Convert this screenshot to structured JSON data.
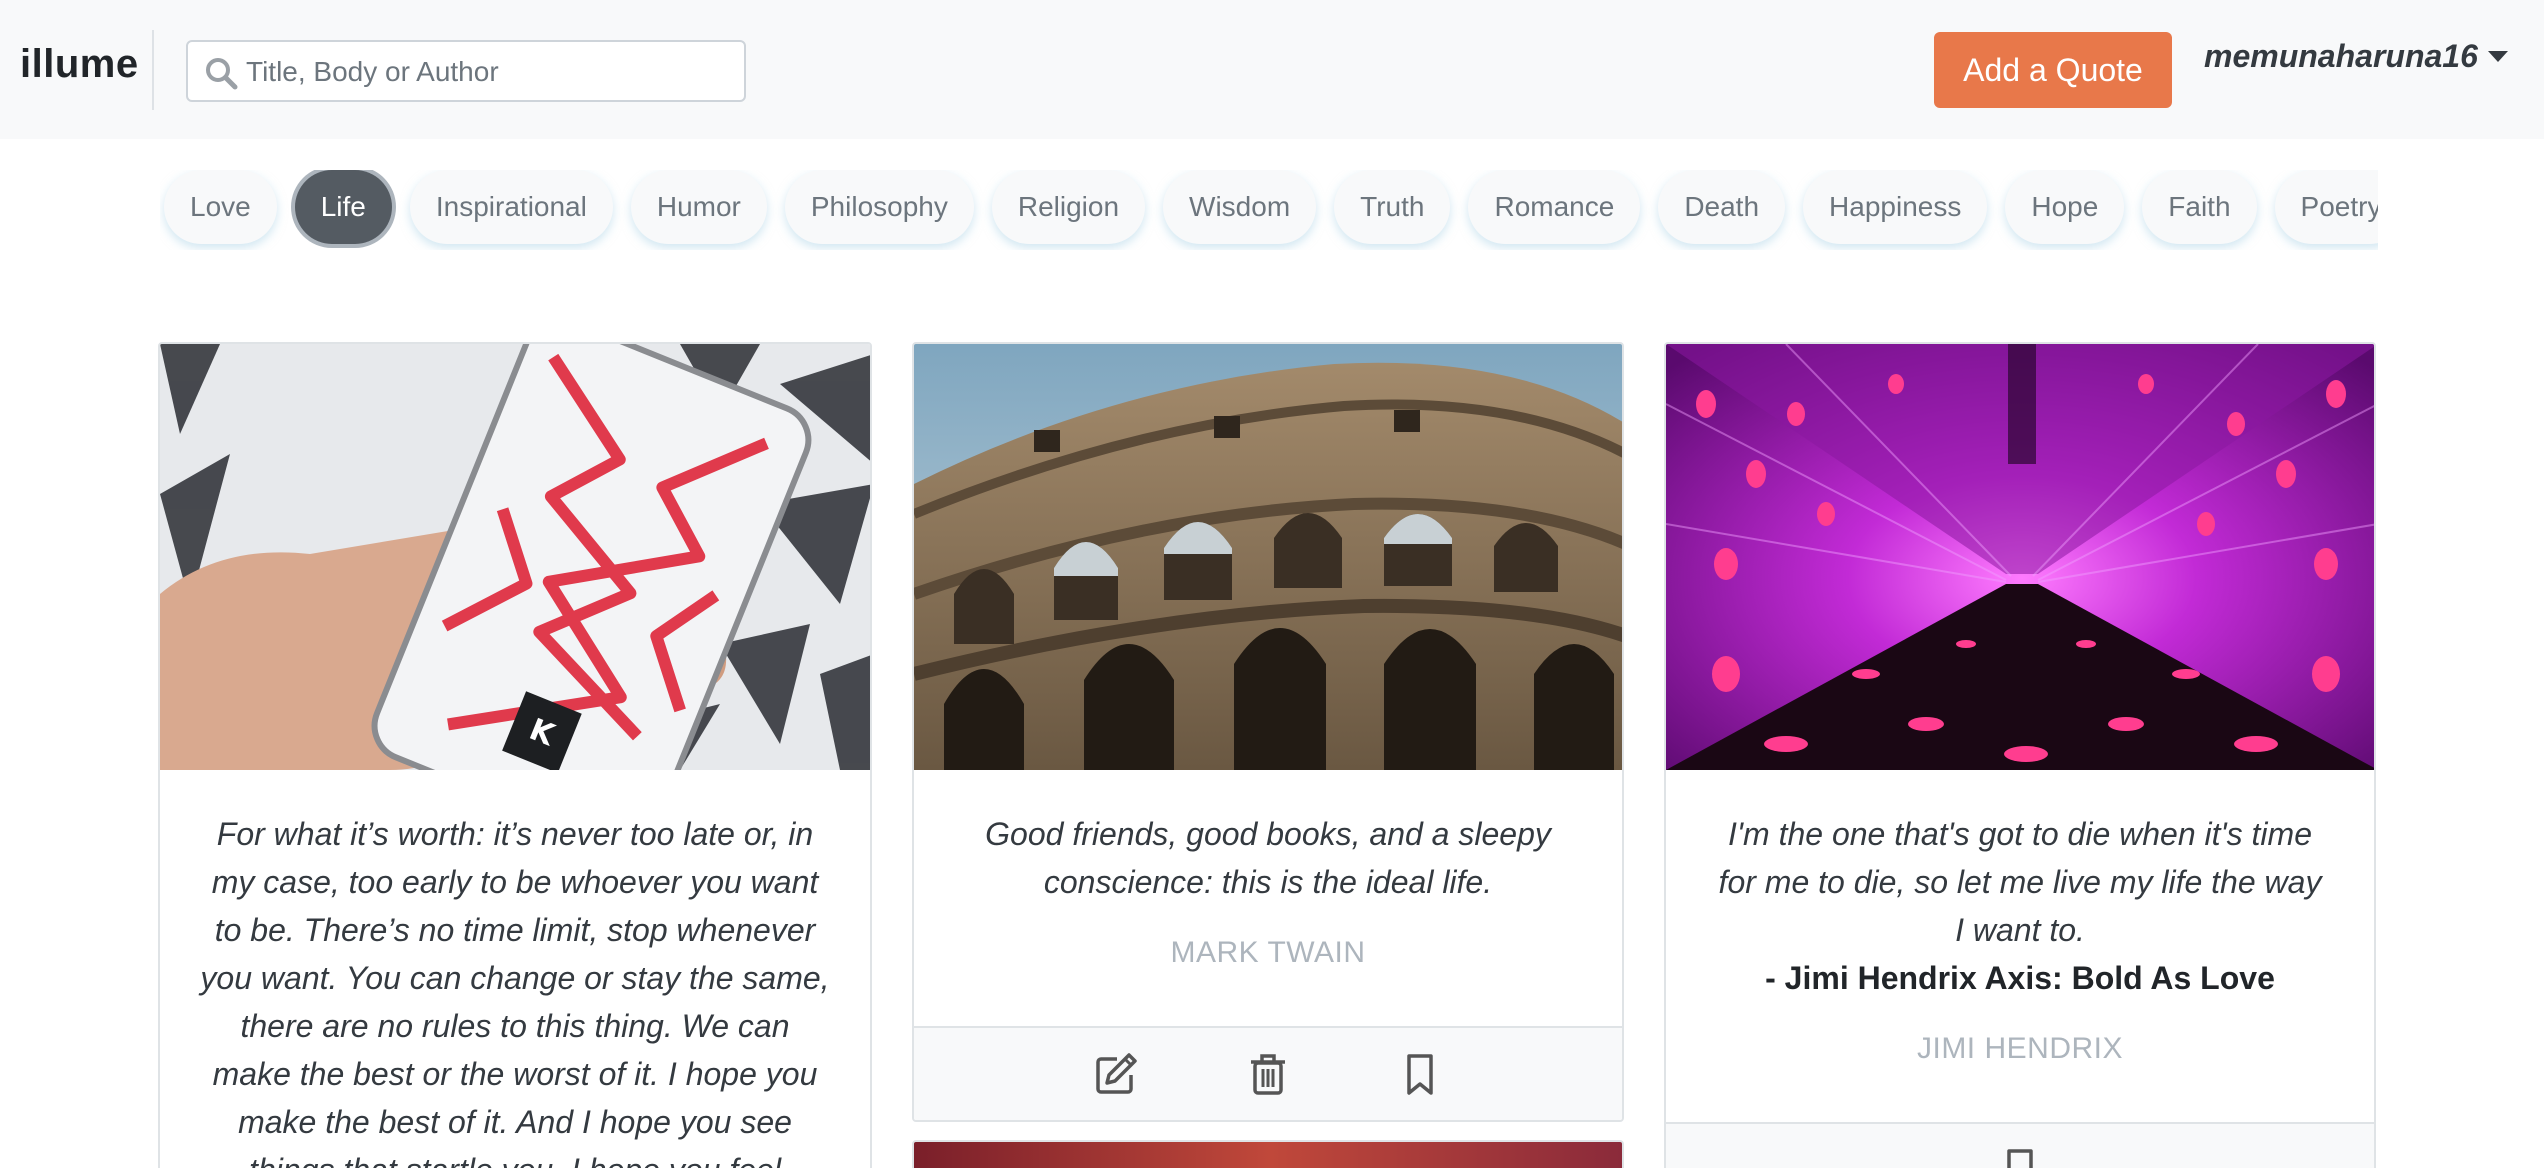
{
  "app": {
    "brand": "illume"
  },
  "search": {
    "placeholder": "Title, Body or Author",
    "value": ""
  },
  "header": {
    "add_quote_label": "Add a Quote",
    "username": "memunaharuna16"
  },
  "categories": {
    "active": "Life",
    "items": [
      "Love",
      "Life",
      "Inspirational",
      "Humor",
      "Philosophy",
      "Religion",
      "Wisdom",
      "Truth",
      "Romance",
      "Death",
      "Happiness",
      "Hope",
      "Faith",
      "Poetry"
    ]
  },
  "cards": [
    {
      "image": "phone-case-photo",
      "quote_lines": [
        "For what it’s worth: it’s never too late or, in",
        "my case, too early to be whoever you want",
        "to be. There’s no time limit, stop whenever",
        "you want. You can change or stay the same,",
        "there are no rules to this thing. We can",
        "make the best or the worst of it. I hope you",
        "make the best of it. And I hope you see",
        "things that startle you. I hope you feel"
      ]
    },
    {
      "image": "colosseum-photo",
      "quote_lines": [
        "Good friends, good books, and a sleepy",
        "conscience: this is the ideal life."
      ],
      "author": "MARK TWAIN",
      "actions": [
        "edit-icon",
        "trash-icon",
        "bookmark-icon"
      ]
    },
    {
      "image": "neon-tunnel-photo",
      "quote_lines": [
        "I'm the one that's got to die when it's time",
        "for me to die, so let me live my life the way",
        "I want to."
      ],
      "subline": "- Jimi Hendrix Axis: Bold As Love",
      "author": "JIMI HENDRIX",
      "actions": [
        "bookmark-icon"
      ]
    }
  ]
}
